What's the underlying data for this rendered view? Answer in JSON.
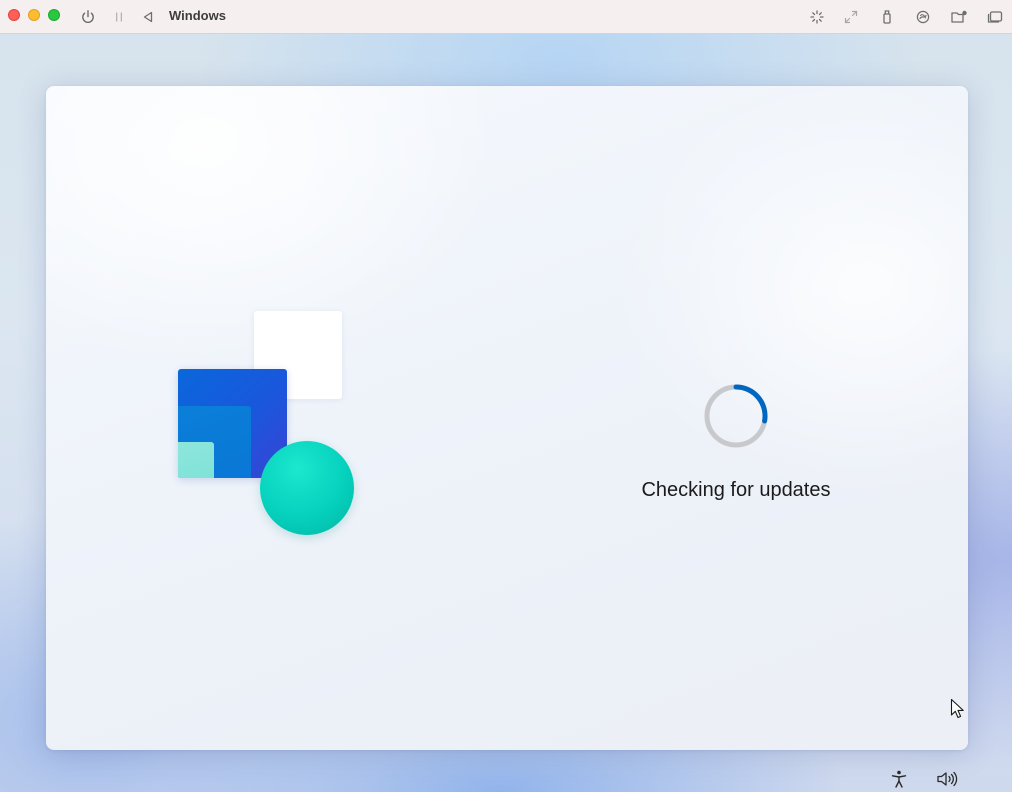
{
  "window": {
    "title": "Windows",
    "controls": {
      "close": "close-button",
      "minimize": "minimize-button",
      "zoom": "zoom-button"
    }
  },
  "toolbar": {
    "left_icons": [
      "power-icon",
      "pause-icon",
      "back-triangle-icon"
    ],
    "right_icons": [
      "brightness-icon",
      "resize-arrows-icon",
      "usb-icon",
      "sharing-icon",
      "shared-folder-icon",
      "windows-switch-icon"
    ]
  },
  "setup": {
    "status": "Checking for updates"
  },
  "bottom_icons": [
    "accessibility-icon",
    "volume-icon"
  ],
  "colors": {
    "spinner_accent": "#0067c0",
    "spinner_track": "#c7c9cc",
    "logo_blue": "#0a67db",
    "logo_teal": "#05d1bd",
    "logo_mint": "#8ee6db"
  }
}
